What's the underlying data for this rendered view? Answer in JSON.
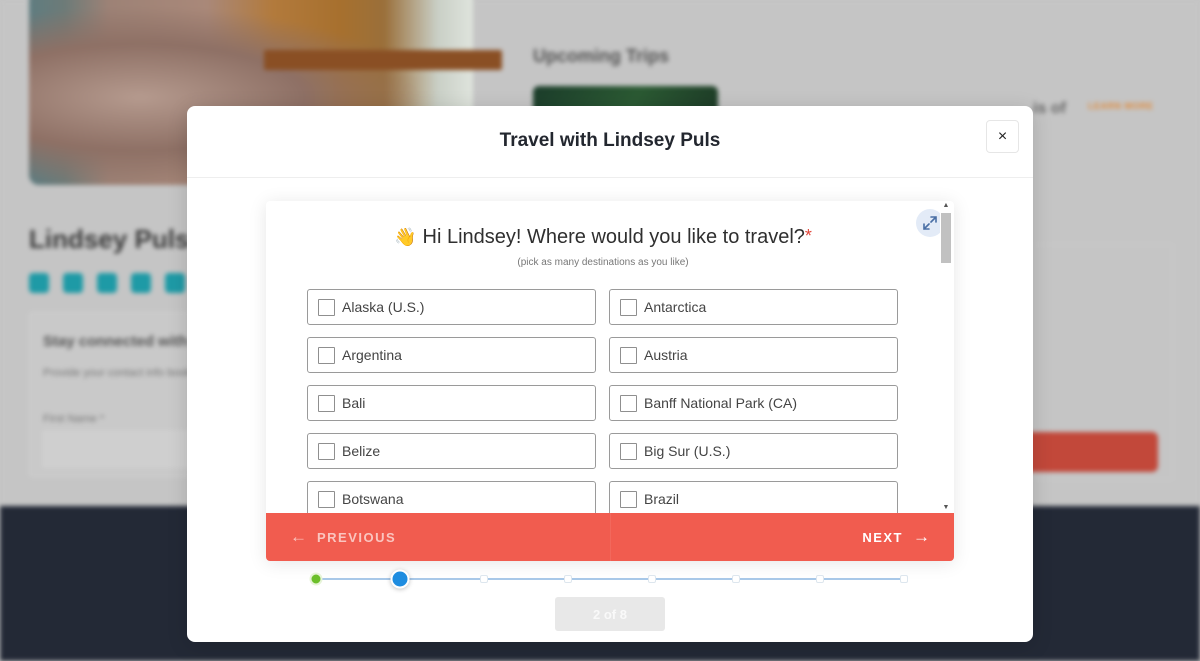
{
  "background": {
    "profile_name": "Lindsey Puls",
    "social_icons": [
      "facebook-icon",
      "twitter-icon",
      "instagram-icon",
      "tiktok-icon",
      "youtube-icon"
    ],
    "form_title": "Stay connected with",
    "form_text": "Provide your contact info book",
    "form_label": "First Name *",
    "upcoming_title": "Upcoming Trips",
    "trip_title": "is of",
    "trip_badge": "LEARN MORE"
  },
  "modal": {
    "title": "Travel with Lindsey Puls",
    "close_label": "×"
  },
  "form": {
    "question_emoji": "👋",
    "question": "Hi Lindsey! Where would you like to travel?",
    "required_mark": "*",
    "hint": "(pick as many destinations as you like)",
    "options": [
      {
        "label": "Alaska (U.S.)",
        "checked": false
      },
      {
        "label": "Antarctica",
        "checked": false
      },
      {
        "label": "Argentina",
        "checked": false
      },
      {
        "label": "Austria",
        "checked": false
      },
      {
        "label": "Bali",
        "checked": false
      },
      {
        "label": "Banff National Park (CA)",
        "checked": false
      },
      {
        "label": "Belize",
        "checked": false
      },
      {
        "label": "Big Sur (U.S.)",
        "checked": false
      },
      {
        "label": "Botswana",
        "checked": false
      },
      {
        "label": "Brazil",
        "checked": false
      }
    ],
    "previous_label": "PREVIOUS",
    "next_label": "NEXT",
    "prev_arrow": "←",
    "next_arrow": "→"
  },
  "progress": {
    "current_step": 2,
    "total_steps": 8,
    "counter_text": "2 of 8"
  },
  "colors": {
    "accent": "#f15c4f",
    "step_done": "#6cbf2a",
    "step_current": "#1f8de0",
    "footer": "#232936"
  }
}
